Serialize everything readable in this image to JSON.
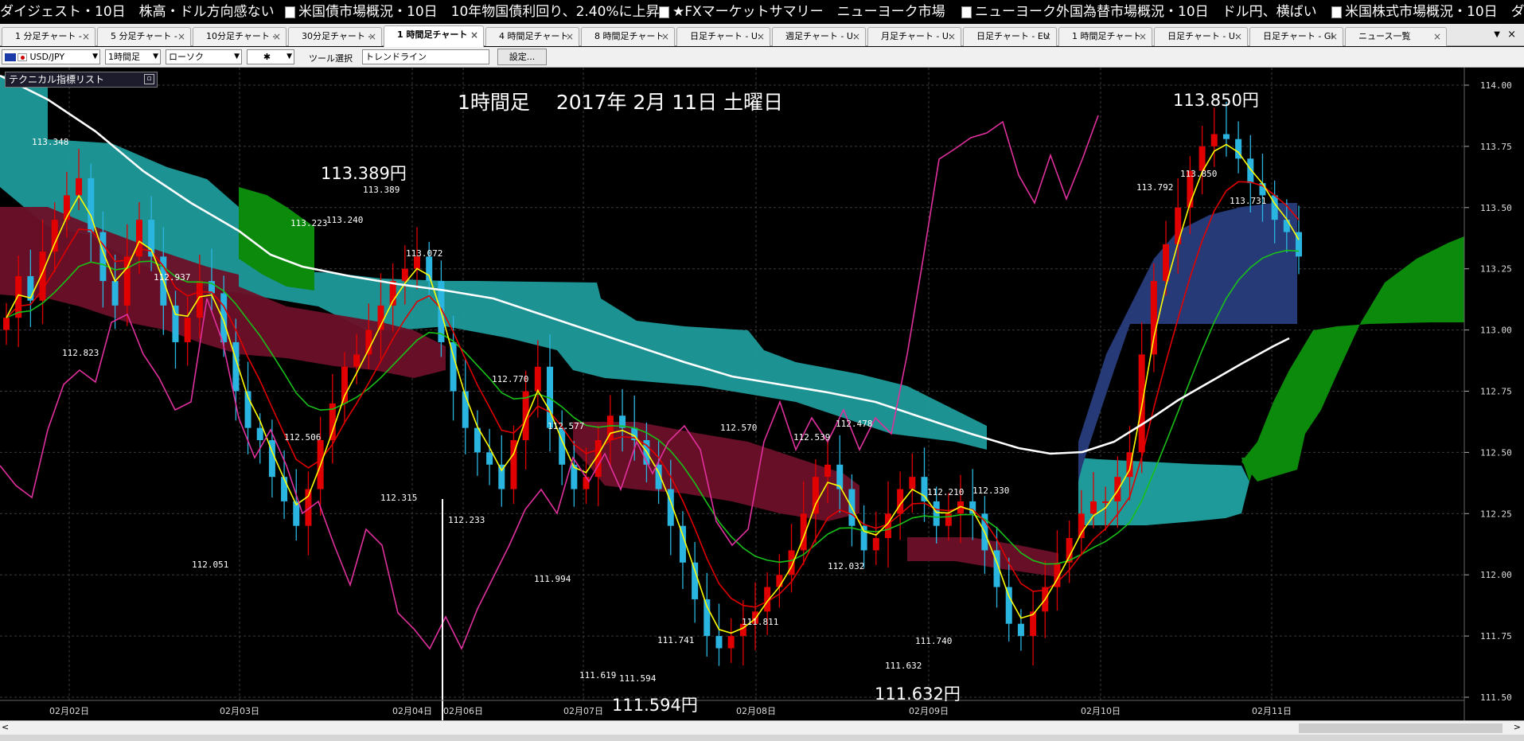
{
  "ticker": {
    "items": [
      {
        "text": "ダイジェスト・10日　株高・ドル方向感ない",
        "icon": "news-icon"
      },
      {
        "text": "米国債市場概況・10日　10年物国債利回り、2.40%に上昇",
        "icon": "news-icon"
      },
      {
        "text": "★FXマーケットサマリー　ニューヨーク市場",
        "icon": "news-icon"
      },
      {
        "text": "ニューヨーク外国為替市場概況・10日　ドル円、横ばい",
        "icon": "news-icon"
      },
      {
        "text": "米国株式市場概況・10日　ダ",
        "icon": "news-icon"
      }
    ]
  },
  "tabs": [
    {
      "label": "1 分足チャート -"
    },
    {
      "label": "5 分足チャート -"
    },
    {
      "label": "10分足チャート -"
    },
    {
      "label": "30分足チャート -"
    },
    {
      "label": "1 時間足チャート",
      "active": true
    },
    {
      "label": "4 時間足チャート"
    },
    {
      "label": "8 時間足チャート"
    },
    {
      "label": "日足チャート - U:"
    },
    {
      "label": "週足チャート - U:"
    },
    {
      "label": "月足チャート - U:"
    },
    {
      "label": "日足チャート - EU"
    },
    {
      "label": "1 時間足チャート"
    },
    {
      "label": "日足チャート - U:"
    },
    {
      "label": "日足チャート - GI"
    },
    {
      "label": "ニュース一覧"
    }
  ],
  "toolbar": {
    "pair": "USD/JPY",
    "timeframe": "1時間足",
    "chart_type": "ローソク",
    "cursor_symbol": "✱",
    "tool_label": "ツール選択",
    "tool_value": "トレンドライン",
    "settings_label": "設定..."
  },
  "chart": {
    "indicator_panel_label": "テクニカル指標リスト",
    "title": "1時間足　 2017年 2月 11日 土曜日",
    "big_labels": [
      "113.389円",
      "113.850円",
      "111.594円",
      "111.632円"
    ],
    "colors": {
      "bull": "#e00000",
      "bear": "#2ab5e0",
      "ema_fast": "#ffff00",
      "ema_mid": "#e00000",
      "ema_slow": "#19c019",
      "ma_long": "#ffffff",
      "rsi": "#e0309e",
      "kumo_teal": "#1f9a9a",
      "kumo_maroon": "#6b1028",
      "kumo_green": "#0c8a0c",
      "kumo_navy": "#263a78"
    }
  },
  "chart_data": {
    "type": "candlestick",
    "symbol": "USD/JPY",
    "yaxis": {
      "ylim": [
        111.5,
        114.0
      ],
      "ticks": [
        "114.00",
        "113.75",
        "113.50",
        "113.25",
        "113.00",
        "112.75",
        "112.50",
        "112.25",
        "112.00",
        "111.75",
        "111.50"
      ]
    },
    "xaxis": {
      "ticks": [
        "02月02日",
        "02月03日",
        "02月04日",
        "02月06日",
        "02月07日",
        "02月08日",
        "02月09日",
        "02月10日",
        "02月11日"
      ]
    },
    "annotations": [
      {
        "text": "113.348",
        "value": 113.95
      },
      {
        "text": "112.823",
        "value": 112.82
      },
      {
        "text": "112.937",
        "value": 112.94
      },
      {
        "text": "113.223",
        "value": 113.22
      },
      {
        "text": "113.240",
        "value": 113.24
      },
      {
        "text": "113.389",
        "value": 113.39
      },
      {
        "text": "113.072",
        "value": 113.07
      },
      {
        "text": "112.506",
        "value": 112.51
      },
      {
        "text": "112.051",
        "value": 112.05
      },
      {
        "text": "112.315",
        "value": 112.32
      },
      {
        "text": "112.233",
        "value": 112.23
      },
      {
        "text": "112.770",
        "value": 112.77
      },
      {
        "text": "112.577",
        "value": 112.58
      },
      {
        "text": "111.994",
        "value": 111.99
      },
      {
        "text": "111.619",
        "value": 111.62
      },
      {
        "text": "111.594",
        "value": 111.59
      },
      {
        "text": "111.741",
        "value": 111.74
      },
      {
        "text": "112.570",
        "value": 112.57
      },
      {
        "text": "111.811",
        "value": 111.81
      },
      {
        "text": "112.539",
        "value": 112.54
      },
      {
        "text": "112.478",
        "value": 112.48
      },
      {
        "text": "112.032",
        "value": 112.03
      },
      {
        "text": "112.210",
        "value": 112.21
      },
      {
        "text": "112.330",
        "value": 112.33
      },
      {
        "text": "111.632",
        "value": 111.63
      },
      {
        "text": "111.740",
        "value": 111.74
      },
      {
        "text": "113.792",
        "value": 113.79
      },
      {
        "text": "113.850",
        "value": 113.85
      },
      {
        "text": "113.731",
        "value": 113.73
      }
    ],
    "close_series": [
      113.05,
      113.22,
      113.12,
      113.32,
      113.45,
      113.55,
      113.62,
      113.4,
      113.2,
      113.1,
      113.3,
      113.45,
      113.3,
      113.1,
      112.95,
      113.05,
      113.2,
      113.15,
      112.95,
      112.75,
      112.6,
      112.55,
      112.4,
      112.3,
      112.2,
      112.35,
      112.55,
      112.7,
      112.85,
      112.9,
      113.0,
      113.1,
      113.2,
      113.25,
      113.3,
      113.2,
      112.95,
      112.75,
      112.6,
      112.5,
      112.45,
      112.35,
      112.55,
      112.75,
      112.85,
      112.6,
      112.45,
      112.35,
      112.4,
      112.55,
      112.65,
      112.6,
      112.55,
      112.45,
      112.35,
      112.2,
      112.05,
      111.9,
      111.75,
      111.7,
      111.75,
      111.8,
      111.85,
      111.95,
      112.0,
      112.1,
      112.25,
      112.4,
      112.45,
      112.35,
      112.2,
      112.1,
      112.15,
      112.25,
      112.35,
      112.4,
      112.3,
      112.2,
      112.25,
      112.3,
      112.25,
      112.1,
      111.95,
      111.8,
      111.75,
      111.85,
      111.95,
      112.05,
      112.15,
      112.25,
      112.3,
      112.3,
      112.4,
      112.5,
      112.9,
      113.2,
      113.35,
      113.5,
      113.65,
      113.75,
      113.8,
      113.78,
      113.7,
      113.6,
      113.55,
      113.45,
      113.4,
      113.3
    ]
  }
}
